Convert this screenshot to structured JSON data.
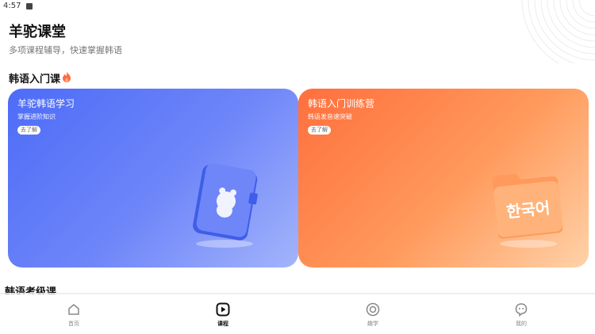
{
  "status": {
    "time": "4:57"
  },
  "header": {
    "title": "羊驼课堂",
    "subtitle": "多项课程辅导，快速掌握韩语"
  },
  "sections": {
    "intro": {
      "title": "韩语入门课",
      "icon": "fire-icon"
    },
    "exam": {
      "title": "韩语考级课"
    }
  },
  "cards": [
    {
      "title": "羊驼韩语学习",
      "desc": "掌握进阶知识",
      "button": "去了解",
      "color": "#5470f8",
      "illus_text": ""
    },
    {
      "title": "韩语入门训练营",
      "desc": "韩语发音速突破",
      "button": "去了解",
      "color": "#ff7a45",
      "illus_text": "한국어"
    }
  ],
  "tabs": [
    {
      "label": "首页",
      "icon": "home-icon",
      "active": false
    },
    {
      "label": "课程",
      "icon": "play-icon",
      "active": true
    },
    {
      "label": "趣学",
      "icon": "circle-icon",
      "active": false
    },
    {
      "label": "我的",
      "icon": "profile-icon",
      "active": false
    }
  ]
}
